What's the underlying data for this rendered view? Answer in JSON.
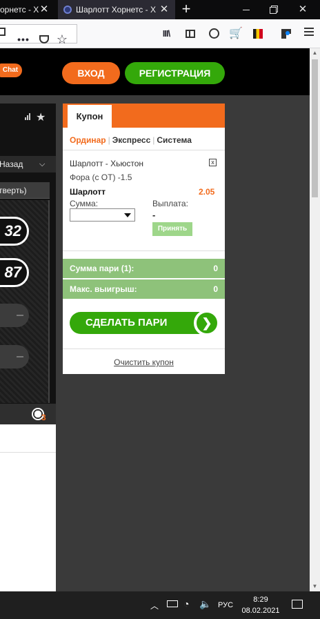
{
  "browser": {
    "tabs": [
      {
        "title": "орнетс - Х",
        "close": "✕"
      },
      {
        "title": "Шарлотт Хорнетс - Х",
        "close": "✕"
      }
    ],
    "new_tab": "+",
    "window_controls": {
      "close": "✕"
    }
  },
  "site": {
    "chat_label": "Chat",
    "login_label": "ВХОД",
    "register_label": "РЕГИСТРАЦИЯ"
  },
  "match_panel": {
    "back_label": "Назад",
    "period_label": "тверть)",
    "score_home": "32",
    "score_away": "87",
    "ball_count": "3"
  },
  "coupon": {
    "tab_label": "Купон",
    "bet_types": [
      "Ординар",
      "Экспресс",
      "Система"
    ],
    "active_bet_type": "Ординар",
    "event": "Шарлотт - Хьюстон",
    "market": "Фора (с ОТ) -1.5",
    "selection": "Шарлотт",
    "odds": "2.05",
    "sum_label": "Сумма:",
    "payout_label": "Выплата:",
    "payout_value": "-",
    "accept_label": "Принять",
    "total_stake_label": "Сумма пари (1):",
    "total_stake_value": "0",
    "max_win_label": "Макс. выигрыш:",
    "max_win_value": "0",
    "make_bet_label": "СДЕЛАТЬ ПАРИ",
    "clear_label": "Очистить купон"
  },
  "taskbar": {
    "language": "РУС",
    "time": "8:29",
    "date": "08.02.2021"
  },
  "colors": {
    "accent_orange": "#f26b1d",
    "accent_green": "#34a80a",
    "sum_bar_green": "#8ec27a"
  },
  "icons": [
    "stats-icon",
    "favorite-star-icon",
    "chevron-down-icon",
    "soccer-ball-icon",
    "remove-x-icon",
    "arrow-right-icon",
    "library-icon",
    "sidebar-icon",
    "account-icon",
    "cart-icon",
    "flag-icon",
    "extension-icon",
    "menu-icon",
    "pocket-icon",
    "bookmark-star-icon"
  ]
}
